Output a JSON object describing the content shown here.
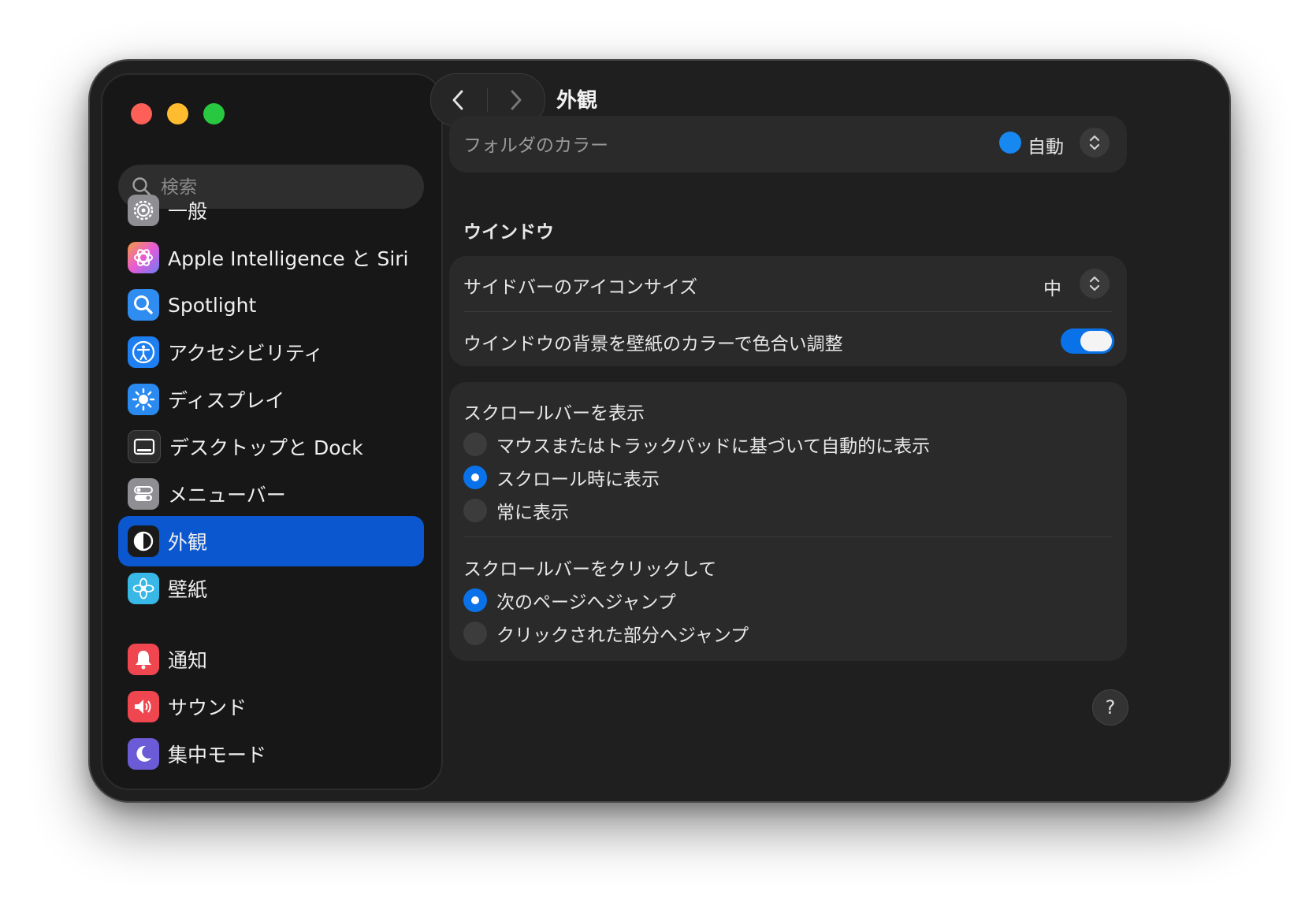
{
  "window": {
    "controls": [
      "close",
      "minimize",
      "zoom"
    ]
  },
  "search": {
    "placeholder": "検索"
  },
  "sidebar": {
    "items": [
      {
        "label": "一般",
        "icon": "gear-icon",
        "color": "#8e8e93"
      },
      {
        "label": "Apple Intelligence と Siri",
        "icon": "apple-intelligence-icon",
        "color": "#e85ad6"
      },
      {
        "label": "Spotlight",
        "icon": "magnifier-icon",
        "color": "#2f8cf0"
      },
      {
        "label": "アクセシビリティ",
        "icon": "accessibility-icon",
        "color": "#1e7ff2"
      },
      {
        "label": "ディスプレイ",
        "icon": "sun-icon",
        "color": "#2a8af0"
      },
      {
        "label": "デスクトップと Dock",
        "icon": "dock-icon",
        "color": "#2b2b2b"
      },
      {
        "label": "メニューバー",
        "icon": "menubar-toggle-icon",
        "color": "#8e8e93"
      },
      {
        "label": "外観",
        "icon": "appearance-icon",
        "color": "#1a1a1a",
        "selected": true
      },
      {
        "label": "壁紙",
        "icon": "flower-icon",
        "color": "#37b8e6"
      },
      {
        "label": "通知",
        "icon": "bell-icon",
        "color": "#f0464f"
      },
      {
        "label": "サウンド",
        "icon": "speaker-icon",
        "color": "#f0464f"
      },
      {
        "label": "集中モード",
        "icon": "moon-icon",
        "color": "#6b5bd6"
      }
    ]
  },
  "header": {
    "title": "外観"
  },
  "folder_color": {
    "label": "フォルダのカラー",
    "value": "自動",
    "color": "#1688f0"
  },
  "window_section": {
    "title": "ウインドウ",
    "icon_size_label": "サイドバーのアイコンサイズ",
    "icon_size_value": "中",
    "tint_label": "ウインドウの背景を壁紙のカラーで色合い調整",
    "tint_on": true
  },
  "scrollbar": {
    "show_title": "スクロールバーを表示",
    "show_options": [
      {
        "label": "マウスまたはトラックパッドに基づいて自動的に表示",
        "selected": false
      },
      {
        "label": "スクロール時に表示",
        "selected": true
      },
      {
        "label": "常に表示",
        "selected": false
      }
    ],
    "click_title": "スクロールバーをクリックして",
    "click_options": [
      {
        "label": "次のページへジャンプ",
        "selected": true
      },
      {
        "label": "クリックされた部分へジャンプ",
        "selected": false
      }
    ]
  },
  "help": {
    "label": "?"
  },
  "colors": {
    "accent": "#0a72e8",
    "selection": "#0b57d0",
    "window_bg": "#1f1f1f",
    "card_bg": "#2a2a2a"
  }
}
